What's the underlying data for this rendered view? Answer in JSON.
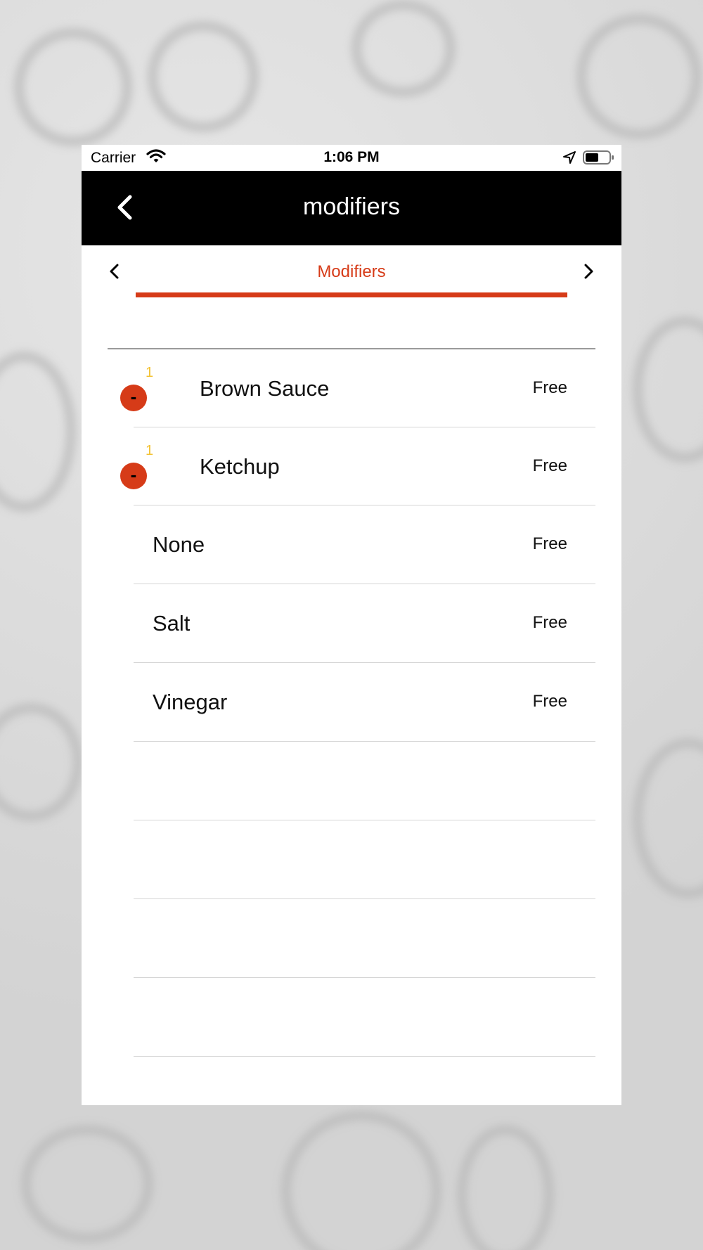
{
  "status_bar": {
    "carrier": "Carrier",
    "time": "1:06 PM"
  },
  "nav": {
    "title": "modifiers",
    "back_icon": "chevron-left-icon"
  },
  "tabs": {
    "active_label": "Modifiers",
    "accent_color": "#d63b18"
  },
  "modifiers": [
    {
      "name": "Brown Sauce",
      "price": "Free",
      "qty": "1",
      "selected": true
    },
    {
      "name": "Ketchup",
      "price": "Free",
      "qty": "1",
      "selected": true
    },
    {
      "name": "None",
      "price": "Free",
      "selected": false
    },
    {
      "name": "Salt",
      "price": "Free",
      "selected": false
    },
    {
      "name": "Vinegar",
      "price": "Free",
      "selected": false
    }
  ],
  "minus_label": "-"
}
